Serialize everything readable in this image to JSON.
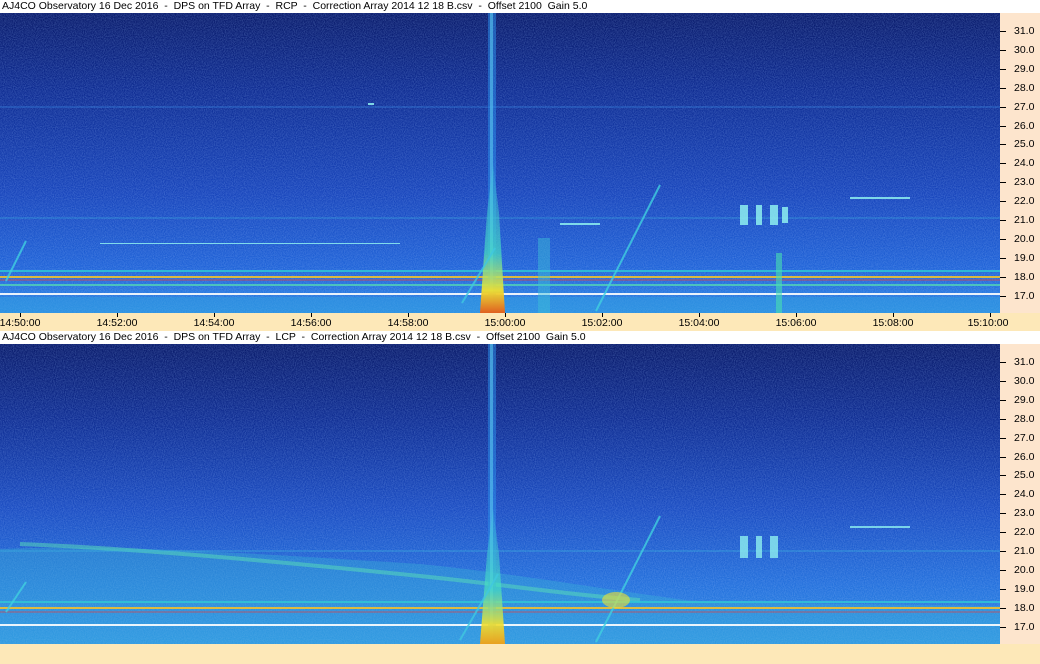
{
  "panels": [
    {
      "id": "rcp",
      "title": "AJ4CO Observatory 16 Dec 2016  -  DPS on TFD Array  -  RCP  -  Correction Array 2014 12 18 B.csv  -  Offset 2100  Gain 5.0",
      "y_ticks": [
        "31.0",
        "30.0",
        "29.0",
        "28.0",
        "27.0",
        "26.0",
        "25.0",
        "24.0",
        "23.0",
        "22.0",
        "21.0",
        "20.0",
        "19.0",
        "18.0",
        "17.0"
      ],
      "x_ticks": [
        "14:50:00",
        "14:52:00",
        "14:54:00",
        "14:56:00",
        "14:58:00",
        "15:00:00",
        "15:02:00",
        "15:04:00",
        "15:06:00",
        "15:08:00",
        "15:10:00"
      ]
    },
    {
      "id": "lcp",
      "title": "AJ4CO Observatory 16 Dec 2016  -  DPS on TFD Array  -  LCP  -  Correction Array 2014 12 18 B.csv  -  Offset 2100  Gain 5.0",
      "y_ticks": [
        "31.0",
        "30.0",
        "29.0",
        "28.0",
        "27.0",
        "26.0",
        "25.0",
        "24.0",
        "23.0",
        "22.0",
        "21.0",
        "20.0",
        "19.0",
        "18.0",
        "17.0"
      ],
      "x_ticks": []
    }
  ],
  "colors": {
    "background_dark": "#0a1a6e",
    "background_mid": "#1a4fcf",
    "emission_cyan": "#3fd0e0",
    "emission_yellow": "#f0e030",
    "axis_bg": "#fde5cd",
    "time_axis_bg": "#fde8b8"
  }
}
